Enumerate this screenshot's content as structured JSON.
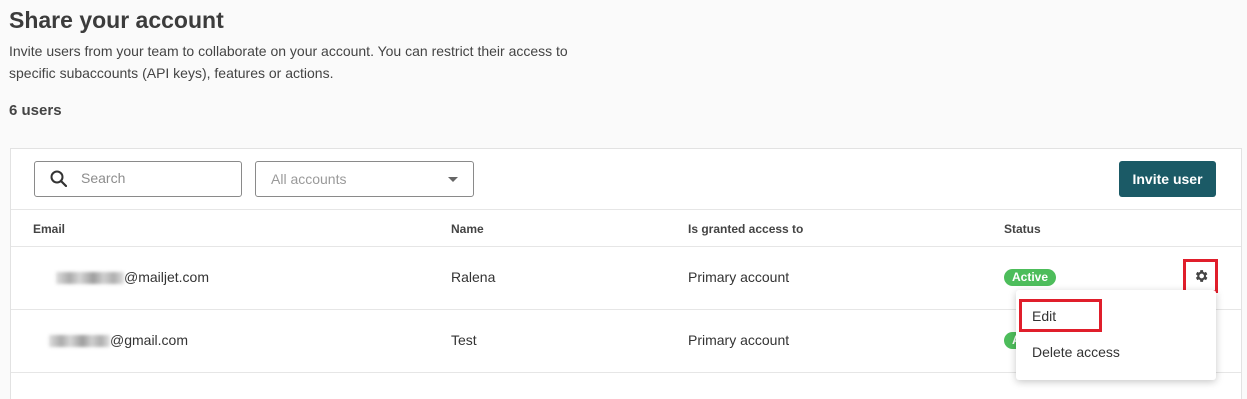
{
  "page": {
    "title": "Share your account",
    "description": "Invite users from your team to collaborate on your account. You can restrict their access to specific subaccounts (API keys), features or actions.",
    "user_count": "6 users"
  },
  "toolbar": {
    "search_placeholder": "Search",
    "account_filter_value": "All accounts",
    "invite_label": "Invite user"
  },
  "table": {
    "columns": [
      "Email",
      "Name",
      "Is granted access to",
      "Status"
    ],
    "rows": [
      {
        "email_domain": "@mailjet.com",
        "name": "Ralena",
        "access": "Primary account",
        "status": "Active"
      },
      {
        "email_domain": "@gmail.com",
        "name": "Test",
        "access": "Primary account",
        "status": "Active"
      }
    ]
  },
  "row_menu": {
    "items": [
      "Edit",
      "Delete access"
    ]
  },
  "colors": {
    "primary_button": "#1b5a66",
    "active_badge": "#4dbd5b",
    "highlight": "#e01e2b"
  },
  "icons": [
    "search-icon",
    "chevron-down-icon",
    "gear-icon"
  ]
}
